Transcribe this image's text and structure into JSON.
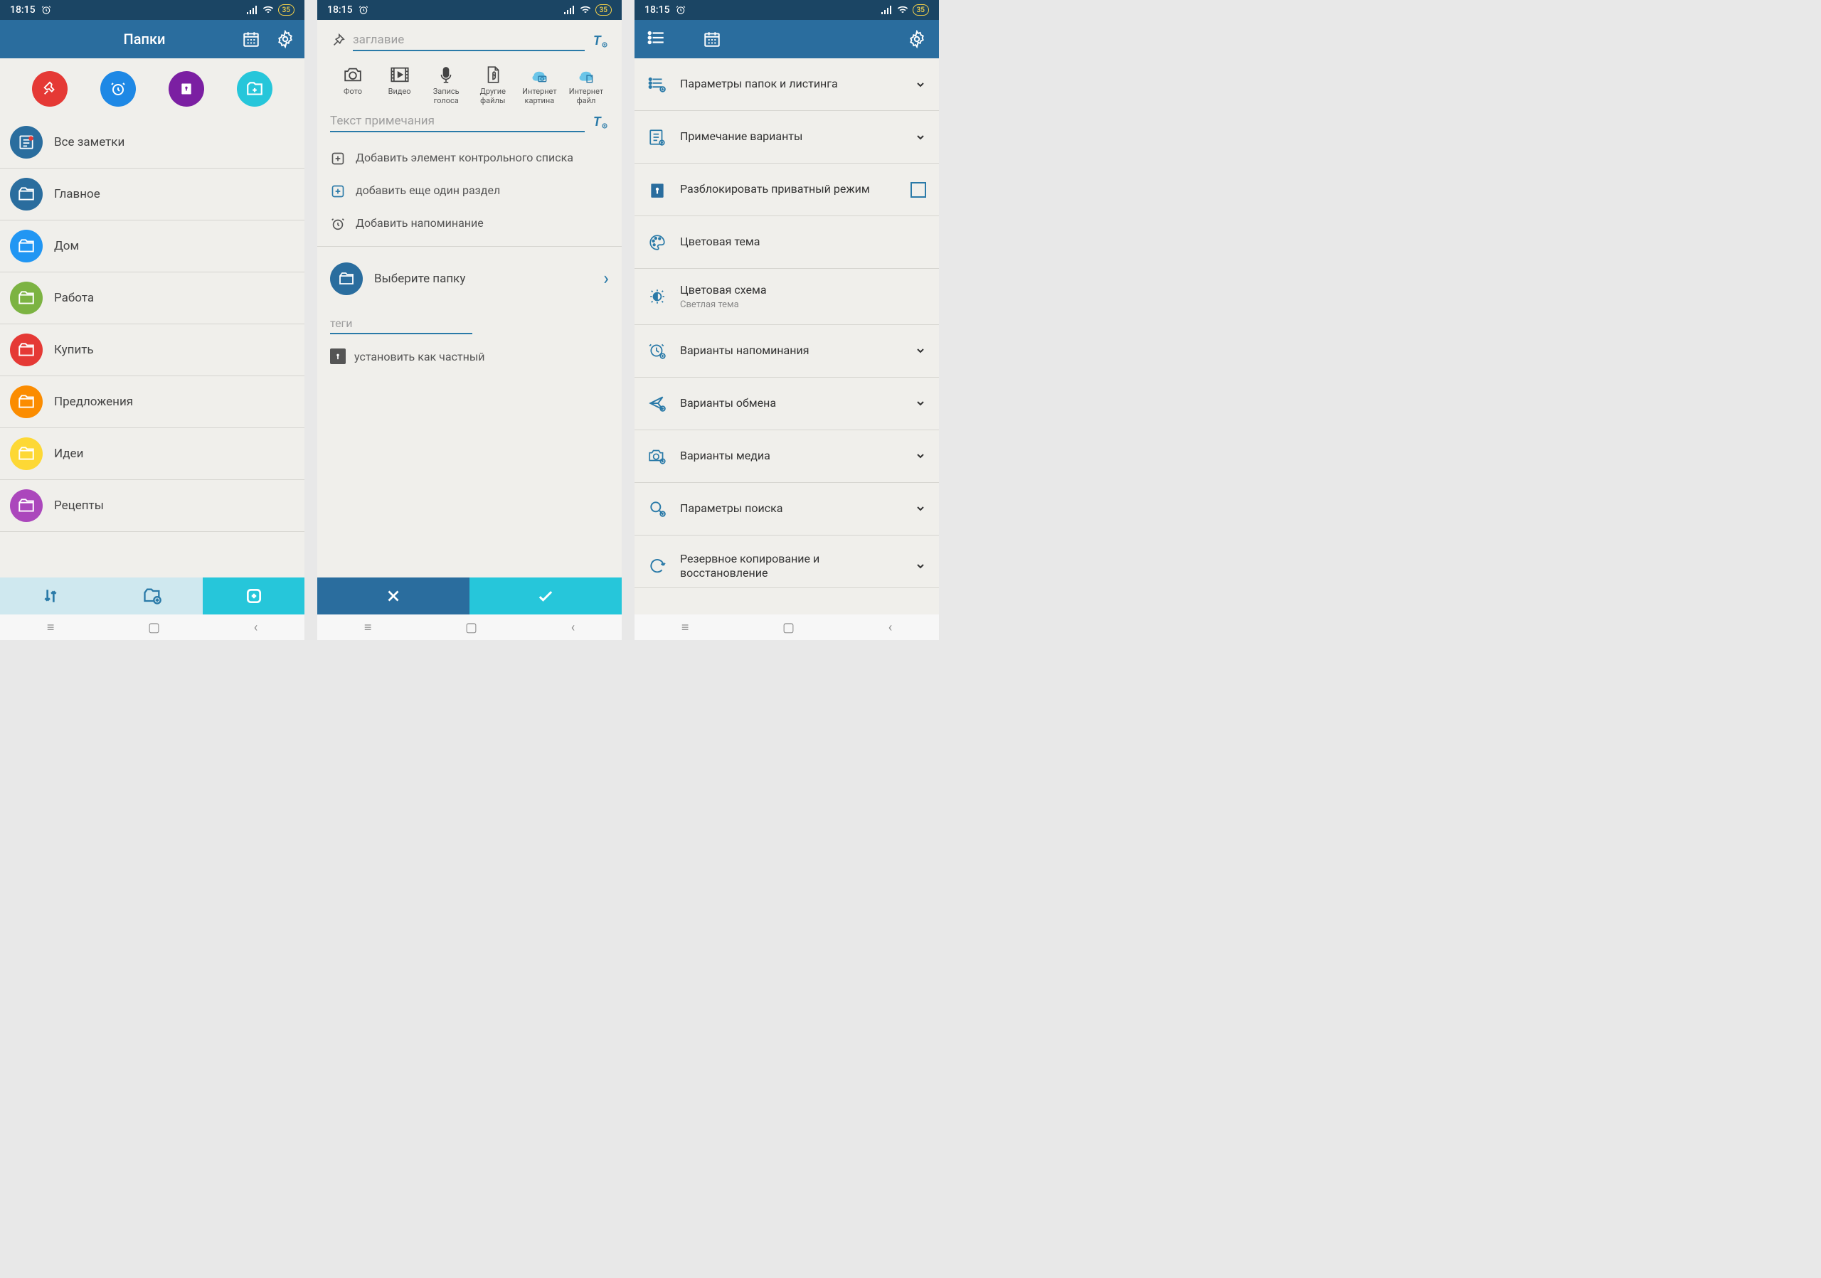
{
  "status": {
    "time": "18:15",
    "battery": "35"
  },
  "screen1": {
    "title": "Папки",
    "folders": [
      {
        "label": "Все заметки"
      },
      {
        "label": "Главное"
      },
      {
        "label": "Дом"
      },
      {
        "label": "Работа"
      },
      {
        "label": "Купить"
      },
      {
        "label": "Предложения"
      },
      {
        "label": "Идеи"
      },
      {
        "label": "Рецепты"
      }
    ]
  },
  "screen2": {
    "title_placeholder": "заглавие",
    "note_placeholder": "Текст примечания",
    "attachments": [
      {
        "label": "Фото"
      },
      {
        "label": "Видео"
      },
      {
        "label": "Запись голоса"
      },
      {
        "label": "Другие файлы"
      },
      {
        "label": "Интернет картина"
      },
      {
        "label": "Интернет файл"
      }
    ],
    "add_checklist": "Добавить элемент контрольного списка",
    "add_section": "добавить еще один раздел",
    "add_reminder": "Добавить напоминание",
    "select_folder": "Выберите папку",
    "tags_placeholder": "теги",
    "set_private": "установить как частный"
  },
  "screen3": {
    "items": [
      {
        "title": "Параметры папок и листинга",
        "expand": true
      },
      {
        "title": "Примечание варианты",
        "expand": true
      },
      {
        "title": "Разблокировать приватный режим",
        "checkbox": true
      },
      {
        "title": "Цветовая тема"
      },
      {
        "title": "Цветовая схема",
        "sub": "Светлая тема"
      },
      {
        "title": "Варианты напоминания",
        "expand": true
      },
      {
        "title": "Варианты обмена",
        "expand": true
      },
      {
        "title": "Варианты медиа",
        "expand": true
      },
      {
        "title": "Параметры поиска",
        "expand": true
      },
      {
        "title": "Резервное копирование и восстановление",
        "expand": true
      }
    ]
  }
}
